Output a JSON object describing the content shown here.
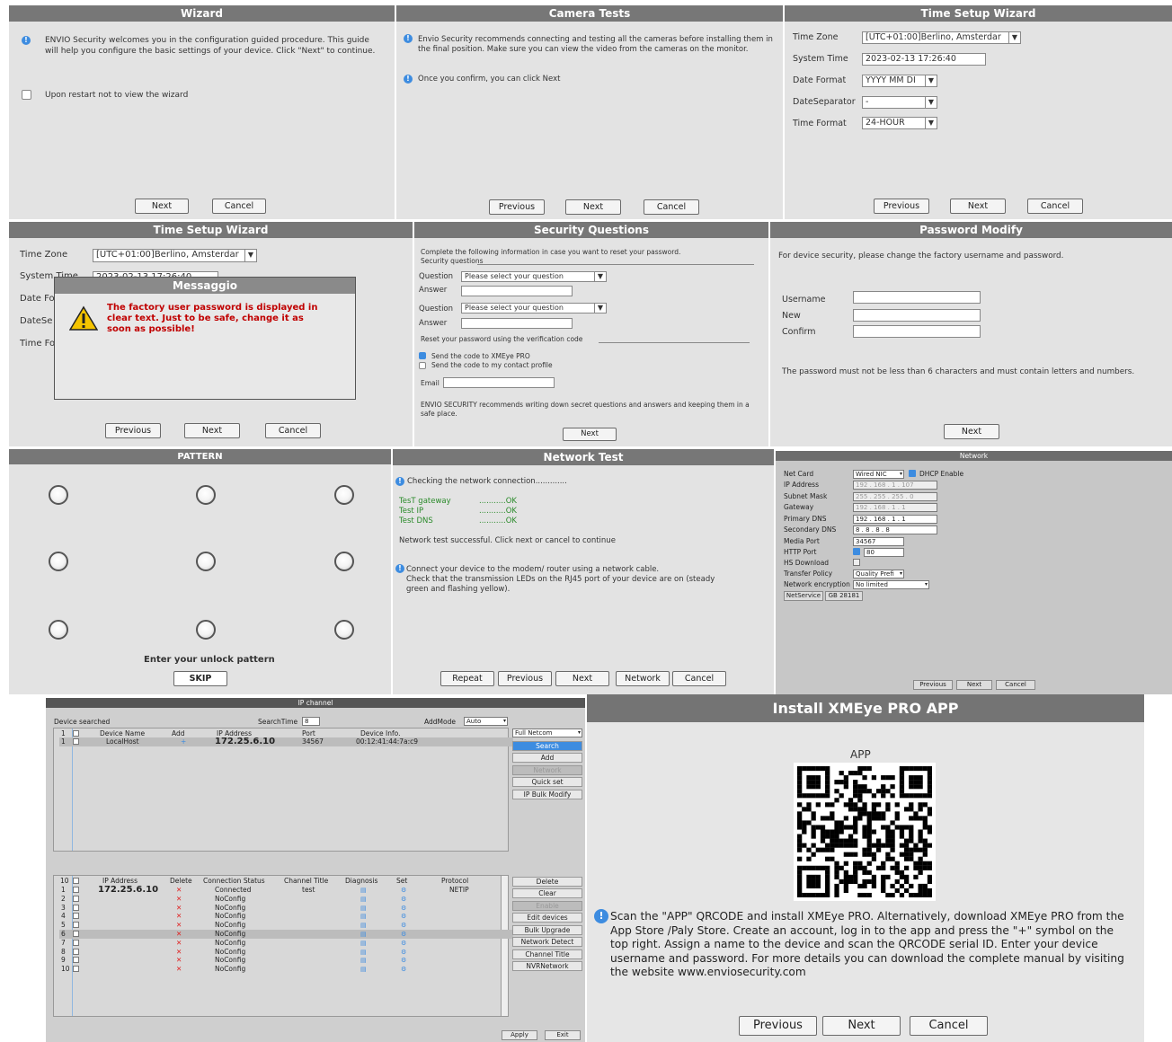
{
  "wizard": {
    "title": "Wizard",
    "text": "ENVIO Security welcomes you in the configuration guided procedure. This guide will help you configure the basic settings of your device. Click \"Next\" to continue.",
    "checkbox_label": "Upon restart not to view the wizard",
    "next": "Next",
    "cancel": "Cancel"
  },
  "camera_tests": {
    "title": "Camera Tests",
    "text1": "Envio Security recommends connecting and testing all the cameras before installing them in the final position. Make sure you can view the video from the cameras on the monitor.",
    "text2": "Once you confirm, you can click Next",
    "previous": "Previous",
    "next": "Next",
    "cancel": "Cancel"
  },
  "time_setup_1": {
    "title": "Time Setup Wizard",
    "time_zone_label": "Time Zone",
    "time_zone_value": "[UTC+01:00]Berlino, Amsterdar",
    "system_time_label": "System Time",
    "system_time_value": "2023-02-13   17:26:40",
    "date_format_label": "Date Format",
    "date_format_value": "YYYY MM DI",
    "date_sep_label": "DateSeparator",
    "date_sep_value": "-",
    "time_format_label": "Time Format",
    "time_format_value": "24-HOUR",
    "previous": "Previous",
    "next": "Next",
    "cancel": "Cancel"
  },
  "time_setup_2": {
    "title": "Time Setup Wizard",
    "time_zone_label": "Time Zone",
    "time_zone_value": "[UTC+01:00]Berlino, Amsterdar",
    "system_time_label": "System Time",
    "system_time_value": "2023-02-13   17:26:40",
    "date_format_label": "Date Fo",
    "date_sep_label": "DateSe",
    "time_format_label": "Time Fo",
    "previous": "Previous",
    "next": "Next",
    "cancel": "Cancel",
    "dialog_title": "Messaggio",
    "dialog_text": "The factory user password is displayed in clear text. Just to be safe, change it as soon as possible!"
  },
  "security_questions": {
    "title": "Security Questions",
    "intro": "Complete the following information in case you want to reset your password.",
    "section1": "Security questions",
    "question_label": "Question",
    "question_placeholder": "Please select your question",
    "answer_label": "Answer",
    "section2": "Reset your password using the verification code",
    "send_xmeye": "Send the code to XMEye PRO",
    "send_contact": "Send the code to my contact profile",
    "email_label": "Email",
    "footer": "ENVIO SECURITY recommends writing down secret questions and answers and keeping them in a safe place.",
    "next": "Next"
  },
  "password_modify": {
    "title": "Password Modify",
    "intro": "For device security, please change the factory username and password.",
    "username_label": "Username",
    "new_label": "New",
    "confirm_label": "Confirm",
    "rule": "The password must not be less than 6 characters and must contain letters and numbers.",
    "next": "Next"
  },
  "pattern": {
    "title": "PATTERN",
    "prompt": "Enter your unlock pattern",
    "skip": "SKIP"
  },
  "network_test": {
    "title": "Network Test",
    "checking": "Checking the network connection.............",
    "tests": [
      {
        "name": "TesT gateway",
        "result": "...........OK"
      },
      {
        "name": "Test IP",
        "result": "...........OK"
      },
      {
        "name": "Test DNS",
        "result": "...........OK"
      }
    ],
    "success": "Network test successful. Click next or cancel to continue",
    "connect1": "Connect your device to the modem/ router using a network cable.",
    "connect2": "Check that the transmission LEDs on the RJ45 port of your device are on (steady",
    "connect3": "green    and flashing yellow).",
    "repeat": "Repeat",
    "previous": "Previous",
    "next": "Next",
    "network": "Network",
    "cancel": "Cancel"
  },
  "network": {
    "title": "Network",
    "net_card_label": "Net Card",
    "net_card_value": "Wired NIC",
    "dhcp_label": "DHCP Enable",
    "ip_label": "IP Address",
    "ip_value": "192 . 168 . 1 . 107",
    "subnet_label": "Subnet Mask",
    "subnet_value": "255 . 255 . 255 . 0",
    "gateway_label": "Gateway",
    "gateway_value": "192 . 168 . 1 . 1",
    "pdns_label": "Primary DNS",
    "pdns_value": "192 . 168 . 1 . 1",
    "sdns_label": "Secondary DNS",
    "sdns_value": "8 . 8 . 8 . 8",
    "media_label": "Media Port",
    "media_value": "34567",
    "http_label": "HTTP Port",
    "http_value": "80",
    "hs_label": "HS Download",
    "transfer_label": "Transfer Policy",
    "transfer_value": "Quality Prefi",
    "enc_label": "Network encryption",
    "enc_value": "No limited",
    "netservice": "NetService",
    "gb": "GB 28181",
    "previous": "Previous",
    "next": "Next",
    "cancel": "Cancel"
  },
  "ip_channel": {
    "title": "IP channel",
    "device_searched": "Device searched",
    "search_time_label": "SearchTime",
    "search_time_value": "8",
    "add_mode_label": "AddMode",
    "add_mode_value": "Auto",
    "top_headers": [
      "Device Name",
      "Add",
      "IP Address",
      "Port",
      "Device Info."
    ],
    "top_row": {
      "num": "1",
      "name": "LocalHost",
      "add": "+",
      "ip": "172.25.6.10",
      "port": "34567",
      "info": "00:12:41:44:7a:c9"
    },
    "top_num": "1",
    "protocol_value": "Full Netcom",
    "side_buttons": [
      "Search",
      "Add",
      "Network",
      "Quick set",
      "IP Bulk Modify"
    ],
    "bottom_count": "10",
    "bottom_headers": [
      "IP Address",
      "Delete",
      "Connection Status",
      "Channel Title",
      "Diagnosis",
      "Set",
      "Protocol"
    ],
    "bottom_rows": [
      {
        "num": "1",
        "ip": "172.25.6.10",
        "del": "✕",
        "status": "Connected",
        "title": "test",
        "proto": "NETIP"
      },
      {
        "num": "2",
        "ip": "",
        "del": "✕",
        "status": "NoConfig",
        "title": "",
        "proto": ""
      },
      {
        "num": "3",
        "ip": "",
        "del": "✕",
        "status": "NoConfig",
        "title": "",
        "proto": ""
      },
      {
        "num": "4",
        "ip": "",
        "del": "✕",
        "status": "NoConfig",
        "title": "",
        "proto": ""
      },
      {
        "num": "5",
        "ip": "",
        "del": "✕",
        "status": "NoConfig",
        "title": "",
        "proto": ""
      },
      {
        "num": "6",
        "ip": "",
        "del": "✕",
        "status": "NoConfig",
        "title": "",
        "proto": ""
      },
      {
        "num": "7",
        "ip": "",
        "del": "✕",
        "status": "NoConfig",
        "title": "",
        "proto": ""
      },
      {
        "num": "8",
        "ip": "",
        "del": "✕",
        "status": "NoConfig",
        "title": "",
        "proto": ""
      },
      {
        "num": "9",
        "ip": "",
        "del": "✕",
        "status": "NoConfig",
        "title": "",
        "proto": ""
      },
      {
        "num": "10",
        "ip": "",
        "del": "✕",
        "status": "NoConfig",
        "title": "",
        "proto": ""
      }
    ],
    "bottom_buttons": [
      "Delete",
      "Clear",
      "Enable",
      "Edit devices",
      "Bulk Upgrade",
      "Network Detect",
      "Channel Title",
      "NVRNetwork"
    ],
    "apply": "Apply",
    "exit": "Exit"
  },
  "install_app": {
    "title": "Install XMEye PRO APP",
    "app_label": "APP",
    "text": "Scan the \"APP\" QRCODE and install XMEye PRO. Alternatively, download XMEye PRO from the App Store /Paly Store. Create an account, log in to the app and press the \"+\" symbol on the top right. Assign a name to the device and scan the QRCODE serial ID. Enter your device username and password. For more details you can download the complete manual by visiting the website www.enviosecurity.com",
    "previous": "Previous",
    "next": "Next",
    "cancel": "Cancel"
  },
  "colors": {
    "title_bar": "#777777",
    "panel_bg": "#e3e3e3",
    "info_blue": "#3d8ce0",
    "warning_red": "#c00000",
    "ok_green": "#2a8a2a"
  }
}
